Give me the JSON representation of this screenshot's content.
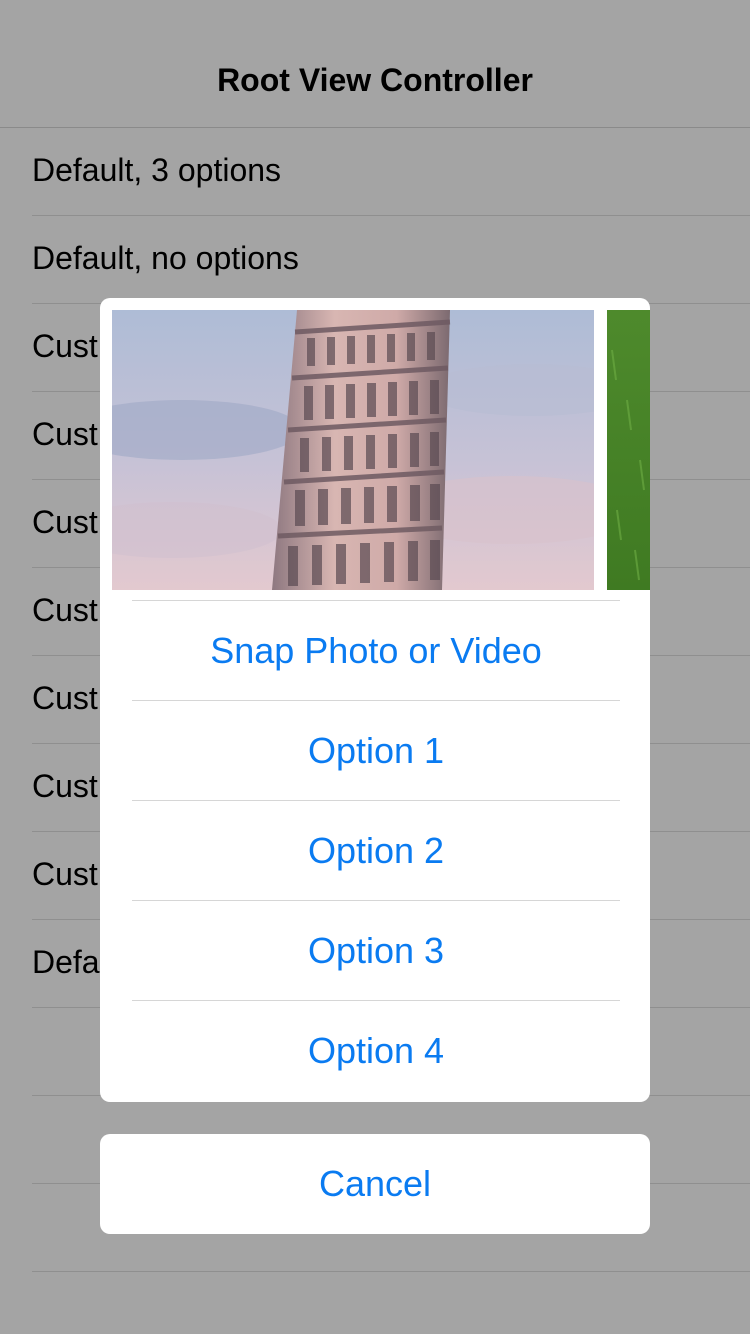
{
  "nav": {
    "title": "Root View Controller"
  },
  "table": {
    "rows": [
      {
        "label": "Default, 3 options"
      },
      {
        "label": "Default, no options"
      },
      {
        "label": "Cust"
      },
      {
        "label": "Cust"
      },
      {
        "label": "Cust"
      },
      {
        "label": "Cust"
      },
      {
        "label": "Cust"
      },
      {
        "label": "Cust"
      },
      {
        "label": "Cust"
      },
      {
        "label": "Defa"
      },
      {
        "label": ""
      },
      {
        "label": ""
      },
      {
        "label": ""
      }
    ]
  },
  "sheet": {
    "actions": [
      {
        "label": "Snap Photo or Video"
      },
      {
        "label": "Option 1"
      },
      {
        "label": "Option 2"
      },
      {
        "label": "Option 3"
      },
      {
        "label": "Option 4"
      }
    ],
    "cancel_label": "Cancel"
  },
  "colors": {
    "accent": "#0a7bf1",
    "dim_background": "#a4a4a4",
    "sheet_background": "#ffffff"
  }
}
